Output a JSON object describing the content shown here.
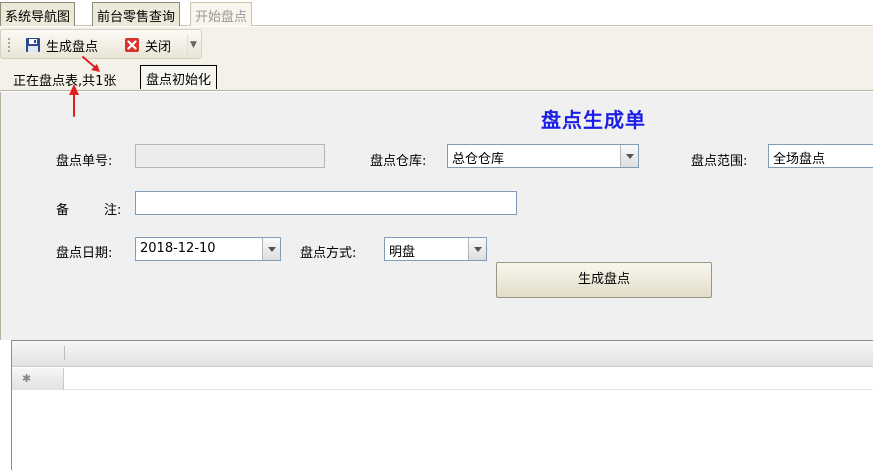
{
  "doc_tabs": [
    {
      "label": "系统导航图"
    },
    {
      "label": "前台零售查询"
    },
    {
      "label": "开始盘点"
    }
  ],
  "toolbar": {
    "generate_label": "生成盘点",
    "close_label": "关闭"
  },
  "inner_tabs": [
    {
      "label": "正在盘点表,共1张"
    },
    {
      "label": "盘点初始化"
    }
  ],
  "form": {
    "title": "盘点生成单",
    "order_no_label": "盘点单号:",
    "order_no_value": "",
    "warehouse_label": "盘点仓库:",
    "warehouse_value": "总仓仓库",
    "scope_label": "盘点范围:",
    "scope_value": "全场盘点",
    "remark_label_a": "备",
    "remark_label_b": "注:",
    "remark_value": "",
    "date_label": "盘点日期:",
    "date_value": "2018-12-10",
    "method_label": "盘点方式:",
    "method_value": "明盘",
    "generate_button": "生成盘点"
  },
  "grid": {
    "new_row_marker": "✱"
  },
  "colors": {
    "title": "#1a1ee6",
    "annotation_arrow": "#e02020"
  }
}
